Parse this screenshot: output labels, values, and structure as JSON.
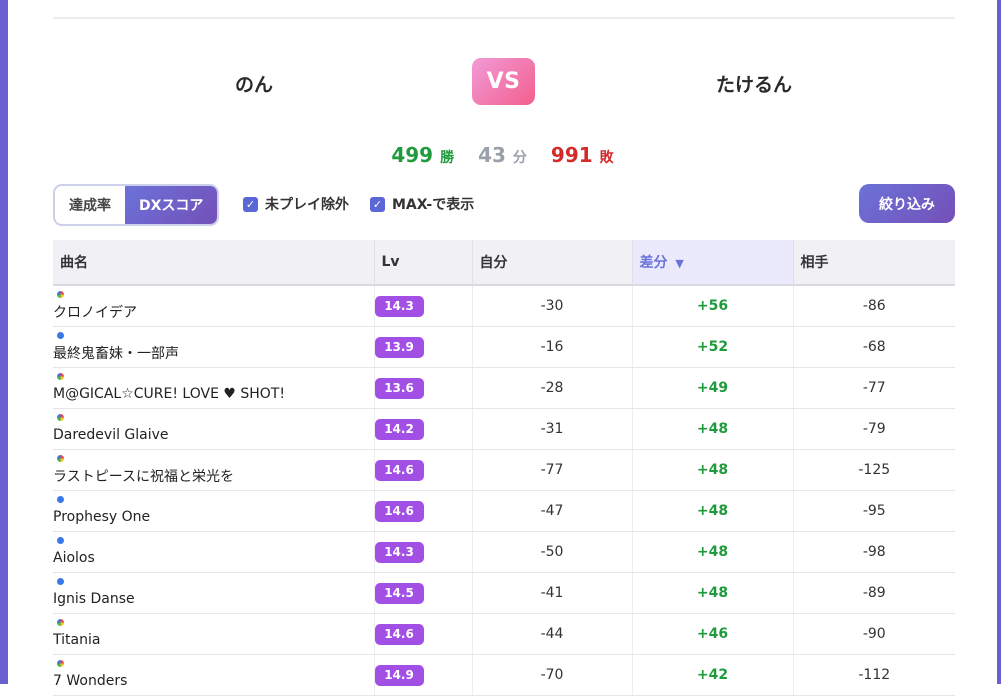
{
  "players": {
    "me": "のん",
    "vs": "VS",
    "opponent": "たけるん"
  },
  "record": {
    "wins": "499",
    "wins_label": "勝",
    "draws": "43",
    "draws_label": "分",
    "losses": "991",
    "losses_label": "敗"
  },
  "controls": {
    "mode_tabs": [
      "達成率",
      "DXスコア"
    ],
    "active_mode": "DXスコア",
    "exclude_unplayed": {
      "label": "未プレイ除外",
      "checked": true
    },
    "show_max_minus": {
      "label": "MAX-で表示",
      "checked": true
    },
    "filter_button": "絞り込み"
  },
  "table": {
    "columns": [
      "曲名",
      "Lv",
      "自分",
      "差分",
      "相手"
    ],
    "sorted_column": "差分",
    "sort_indicator": "▼",
    "rows": [
      {
        "type_icon": "dx-icon",
        "title": "クロノイデア",
        "lv": "14.3",
        "me": "-30",
        "diff": "+56",
        "opp": "-86"
      },
      {
        "type_icon": "standard-icon",
        "title": "最終鬼畜妹・一部声",
        "lv": "13.9",
        "me": "-16",
        "diff": "+52",
        "opp": "-68"
      },
      {
        "type_icon": "dx-icon",
        "title": "M@GICAL☆CURE! LOVE ♥ SHOT!",
        "lv": "13.6",
        "me": "-28",
        "diff": "+49",
        "opp": "-77"
      },
      {
        "type_icon": "dx-icon",
        "title": "Daredevil Glaive",
        "lv": "14.2",
        "me": "-31",
        "diff": "+48",
        "opp": "-79"
      },
      {
        "type_icon": "dx-icon",
        "title": "ラストピースに祝福と栄光を",
        "lv": "14.6",
        "me": "-77",
        "diff": "+48",
        "opp": "-125"
      },
      {
        "type_icon": "standard-icon",
        "title": "Prophesy One",
        "lv": "14.6",
        "me": "-47",
        "diff": "+48",
        "opp": "-95"
      },
      {
        "type_icon": "standard-icon",
        "title": "Aiolos",
        "lv": "14.3",
        "me": "-50",
        "diff": "+48",
        "opp": "-98"
      },
      {
        "type_icon": "standard-icon",
        "title": "Ignis Danse",
        "lv": "14.5",
        "me": "-41",
        "diff": "+48",
        "opp": "-89"
      },
      {
        "type_icon": "dx-icon",
        "title": "Titania",
        "lv": "14.6",
        "me": "-44",
        "diff": "+46",
        "opp": "-90"
      },
      {
        "type_icon": "dx-icon",
        "title": "7 Wonders",
        "lv": "14.9",
        "me": "-70",
        "diff": "+42",
        "opp": "-112"
      }
    ]
  },
  "colors": {
    "accent": "#6b72d8",
    "win": "#1f9a3c",
    "draw": "#9aa0aa",
    "loss": "#d32a2a",
    "level_badge": "#a24fe6"
  }
}
